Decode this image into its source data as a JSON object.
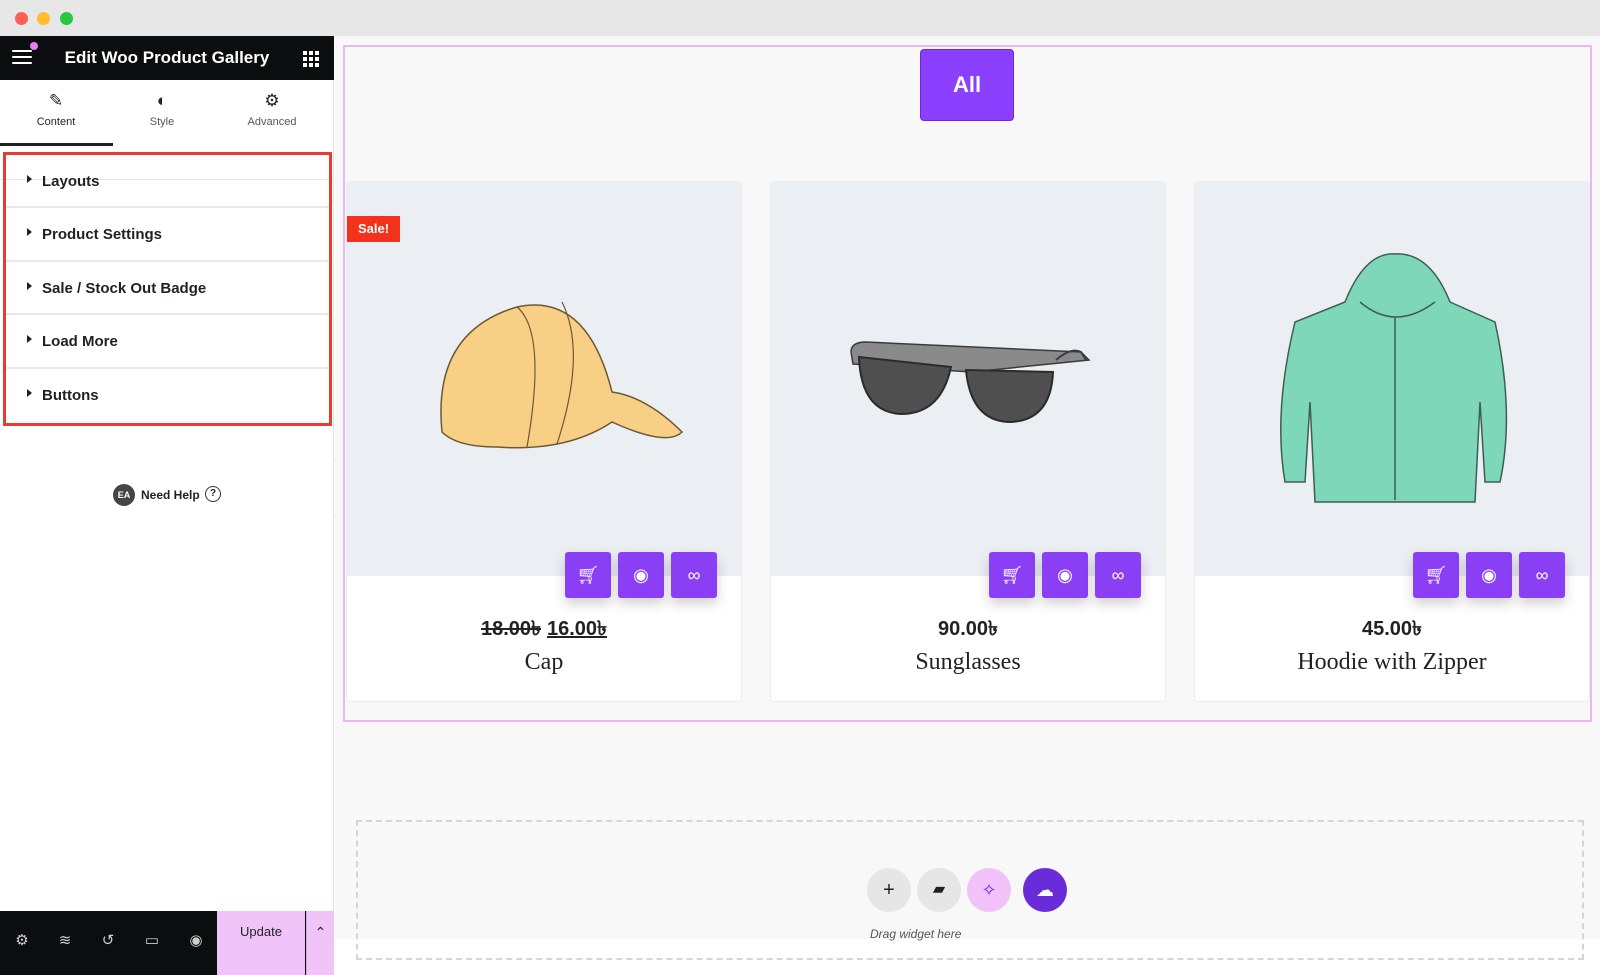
{
  "window": {
    "controls": [
      "close",
      "minimize",
      "maximize"
    ]
  },
  "panel": {
    "title": "Edit Woo Product Gallery",
    "tabs": [
      {
        "label": "Content",
        "icon": "pencil-icon"
      },
      {
        "label": "Style",
        "icon": "half-circle-icon"
      },
      {
        "label": "Advanced",
        "icon": "gear-icon"
      }
    ],
    "sections": [
      {
        "label": "Layouts"
      },
      {
        "label": "Product Settings"
      },
      {
        "label": "Sale / Stock Out Badge"
      },
      {
        "label": "Load More"
      },
      {
        "label": "Buttons"
      }
    ],
    "help": {
      "badge": "EA",
      "label": "Need Help",
      "icon": "?"
    },
    "footer": {
      "update_label": "Update",
      "icons": [
        "gear-icon",
        "layers-icon",
        "history-icon",
        "responsive-icon",
        "eye-icon"
      ]
    }
  },
  "canvas": {
    "filter": {
      "all_label": "All"
    },
    "products": [
      {
        "name": "Cap",
        "old_price": "18.00৳",
        "price": "16.00৳",
        "badge": "Sale!"
      },
      {
        "name": "Sunglasses",
        "price": "90.00৳"
      },
      {
        "name": "Hoodie with Zipper",
        "price": "45.00৳"
      }
    ],
    "dropzone": {
      "text": "Drag widget here"
    },
    "colors": {
      "accent": "#8b3fff",
      "sale": "#f4311b",
      "highlight": "#e93b2f"
    }
  }
}
